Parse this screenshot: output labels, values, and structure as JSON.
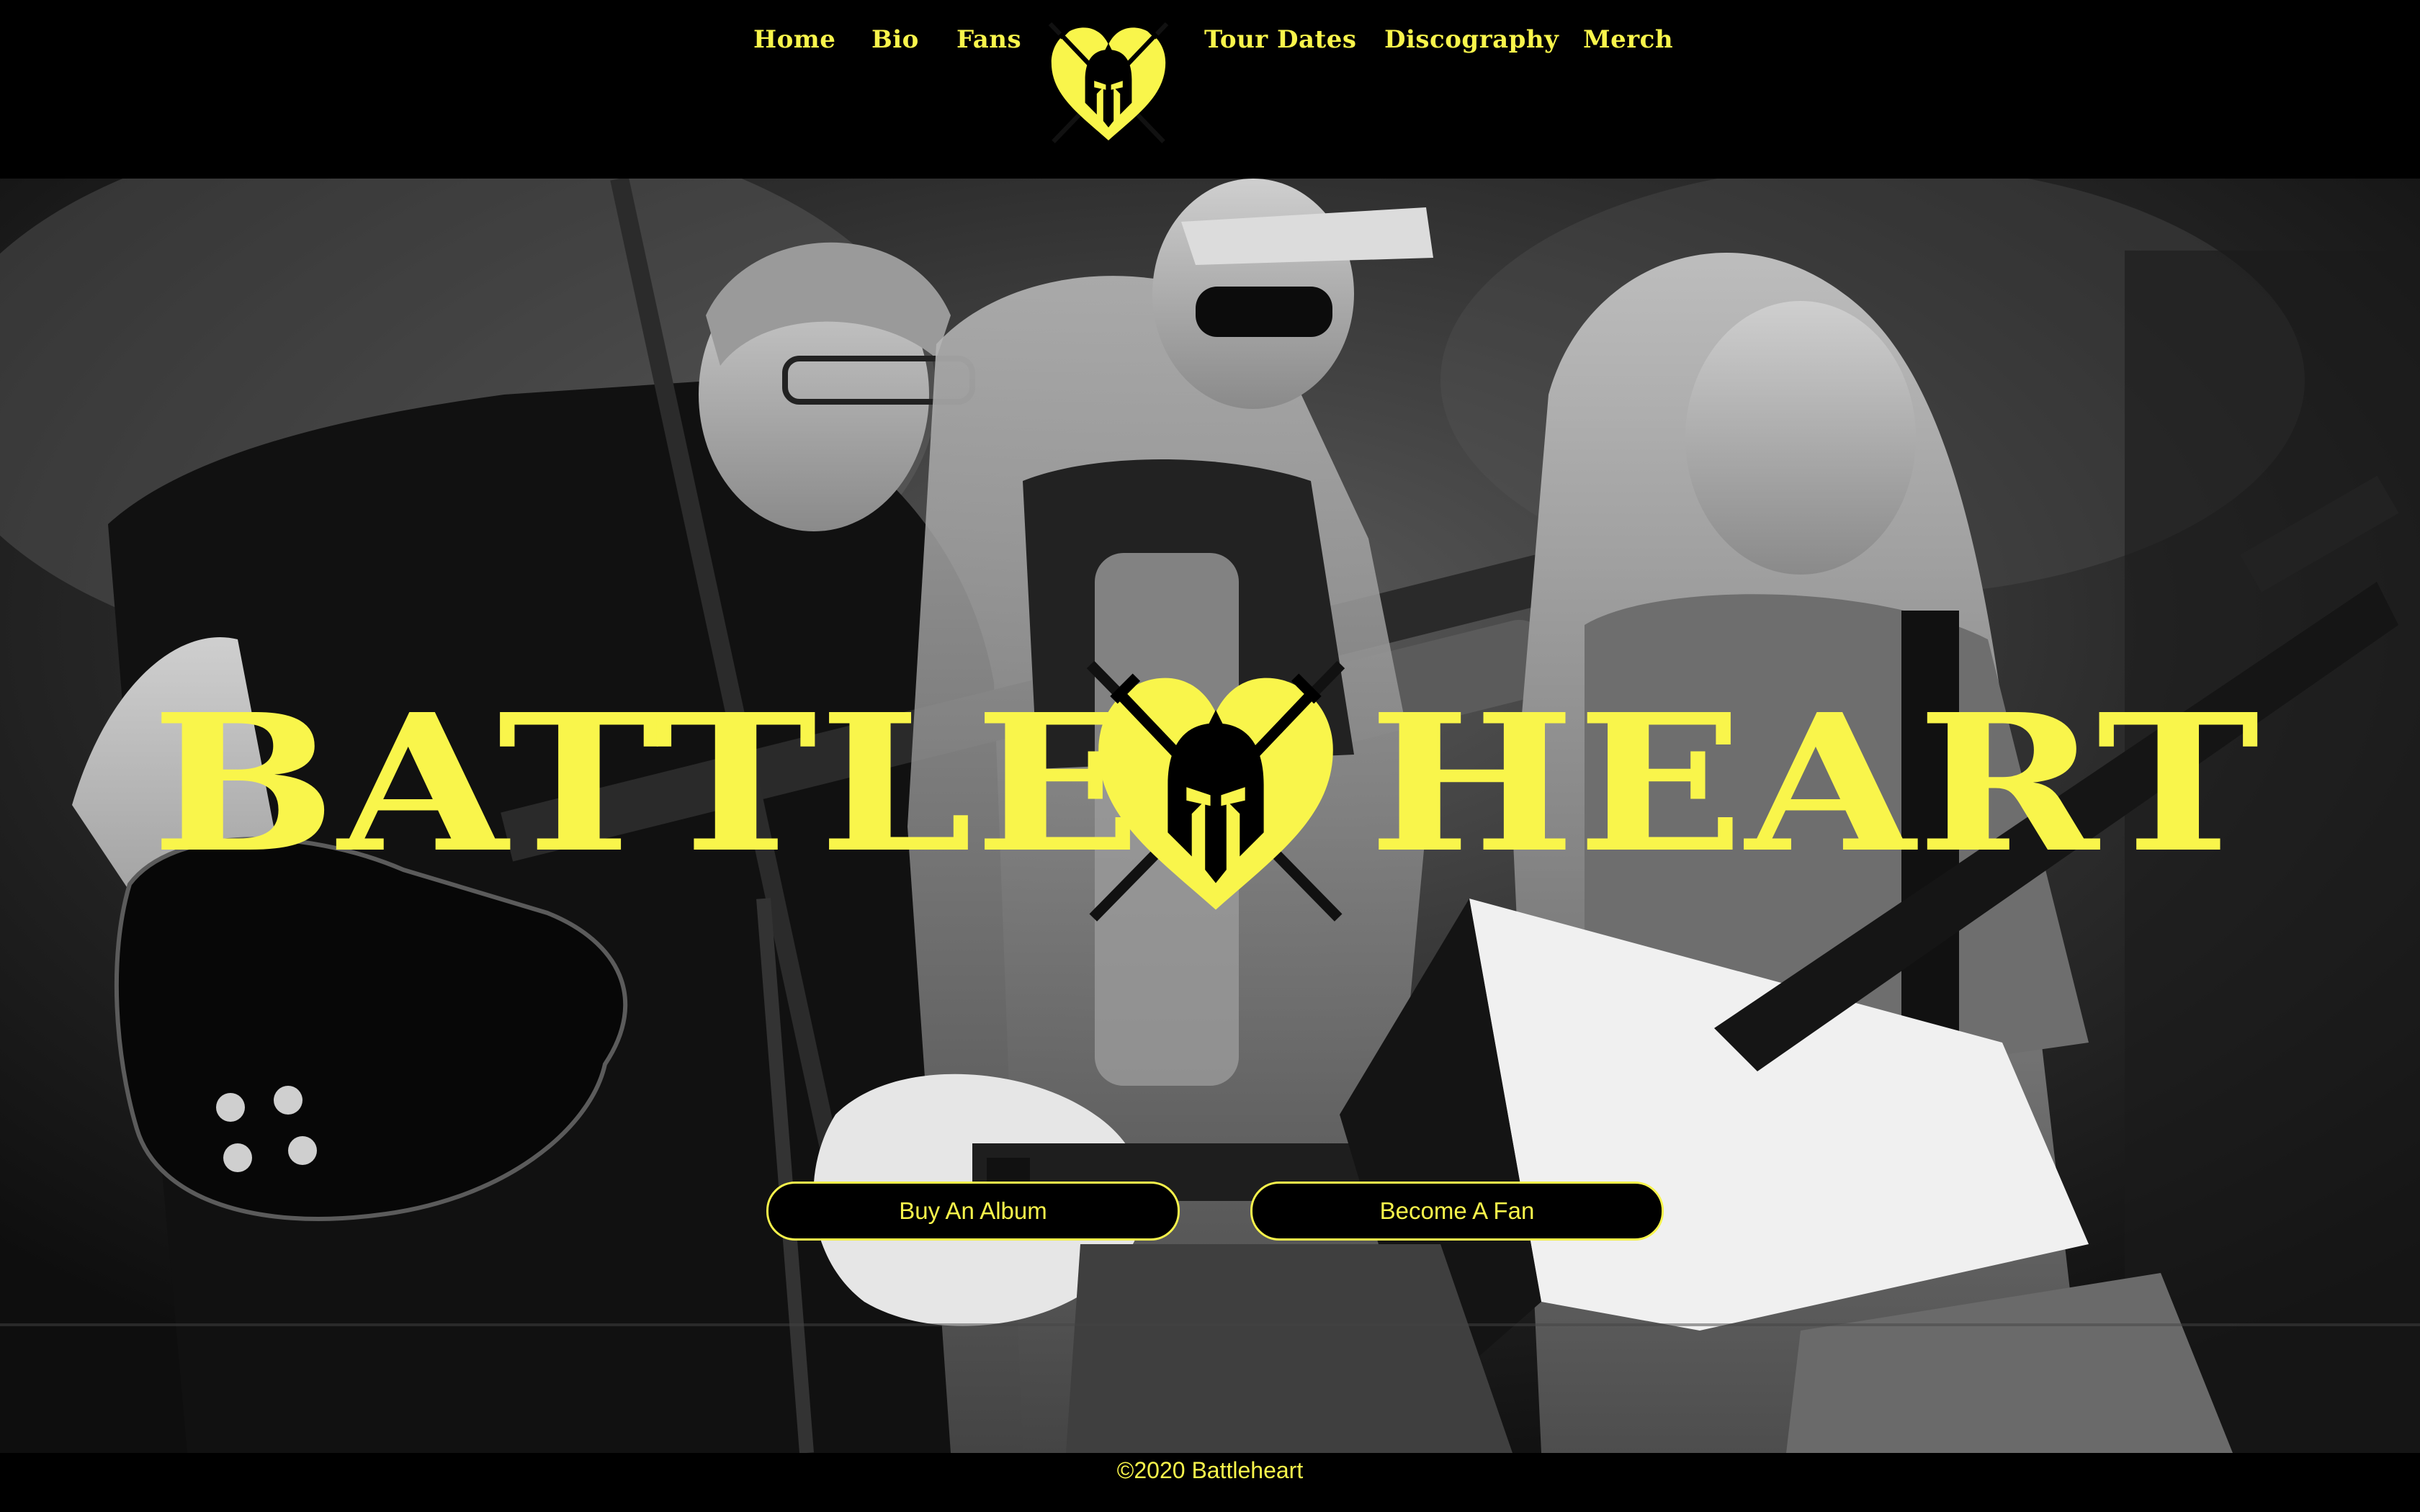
{
  "colors": {
    "accent": "#f9f54b",
    "background": "#000000"
  },
  "nav": {
    "items": [
      {
        "label": "Home"
      },
      {
        "label": "Bio"
      },
      {
        "label": "Fans"
      },
      {
        "label": "Tour Dates"
      },
      {
        "label": "Discography"
      },
      {
        "label": "Merch"
      }
    ],
    "logo_icon": "heart-helmet-swords-icon"
  },
  "hero": {
    "photo": "black-and-white band photo of three guitarists on stage",
    "wordmark_left": "BATTLE",
    "wordmark_right": "HEART",
    "wordmark_icon": "heart-helmet-swords-icon",
    "buttons": {
      "album": "Buy An Album",
      "fan": "Become A Fan"
    }
  },
  "footer": {
    "copyright": "©2020 Battleheart"
  }
}
